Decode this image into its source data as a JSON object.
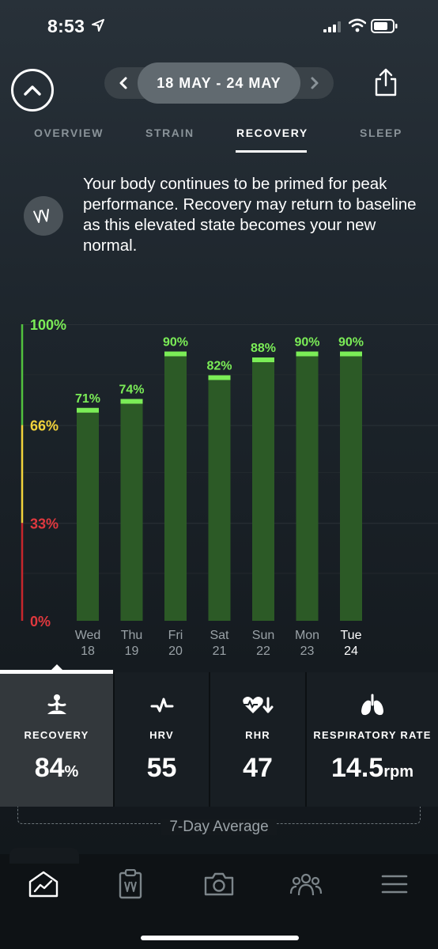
{
  "status_bar": {
    "time": "8:53"
  },
  "header": {
    "date_range": "18 MAY - 24 MAY",
    "prev_icon": "chevron-left-icon",
    "next_icon": "chevron-right-icon",
    "collapse_icon": "chevron-up-icon",
    "share_icon": "share-icon"
  },
  "tabs": [
    {
      "label": "OVERVIEW"
    },
    {
      "label": "STRAIN"
    },
    {
      "label": "RECOVERY",
      "active": true
    },
    {
      "label": "SLEEP"
    }
  ],
  "insight": {
    "icon": "whoop-logo-icon",
    "text": "Your body continues to be primed for peak performance. Recovery may return to baseline as this elevated state becomes your new normal."
  },
  "chart_data": {
    "type": "bar",
    "categories": [
      "Wed 18",
      "Thu 19",
      "Fri 20",
      "Sat 21",
      "Sun 22",
      "Mon 23",
      "Tue 24"
    ],
    "day_names": [
      "Wed",
      "Thu",
      "Fri",
      "Sat",
      "Sun",
      "Mon",
      "Tue"
    ],
    "day_numbers": [
      "18",
      "19",
      "20",
      "21",
      "22",
      "23",
      "24"
    ],
    "values": [
      71,
      74,
      90,
      82,
      88,
      90,
      90
    ],
    "value_labels": [
      "71%",
      "74%",
      "90%",
      "82%",
      "88%",
      "90%",
      "90%"
    ],
    "y_ticks": [
      "100%",
      "66%",
      "33%",
      "0%"
    ],
    "ylim": [
      0,
      100
    ],
    "zones": [
      {
        "from": 0,
        "to": 33,
        "color": "#c7262c"
      },
      {
        "from": 33,
        "to": 66,
        "color": "#f2d33b"
      },
      {
        "from": 66,
        "to": 100,
        "color": "#52c13e"
      }
    ],
    "bar_color": "#2c5a26",
    "bar_cap_color": "#7bed57",
    "highlight_last": true
  },
  "metrics": [
    {
      "label": "RECOVERY",
      "value": "84",
      "unit": "%",
      "icon": "meditation-icon",
      "active": true
    },
    {
      "label": "HRV",
      "value": "55",
      "unit": "",
      "icon": "pulse-icon"
    },
    {
      "label": "RHR",
      "value": "47",
      "unit": "",
      "icon": "heart-down-icon"
    },
    {
      "label": "RESPIRATORY RATE",
      "value": "14.5",
      "unit": "rpm",
      "icon": "lungs-icon"
    }
  ],
  "average_label": "7-Day Average",
  "bottom_nav": [
    {
      "name": "home",
      "icon": "home-chart-icon",
      "active": true
    },
    {
      "name": "journal",
      "icon": "clipboard-icon"
    },
    {
      "name": "camera",
      "icon": "camera-icon"
    },
    {
      "name": "community",
      "icon": "people-icon"
    },
    {
      "name": "menu",
      "icon": "menu-icon"
    }
  ]
}
